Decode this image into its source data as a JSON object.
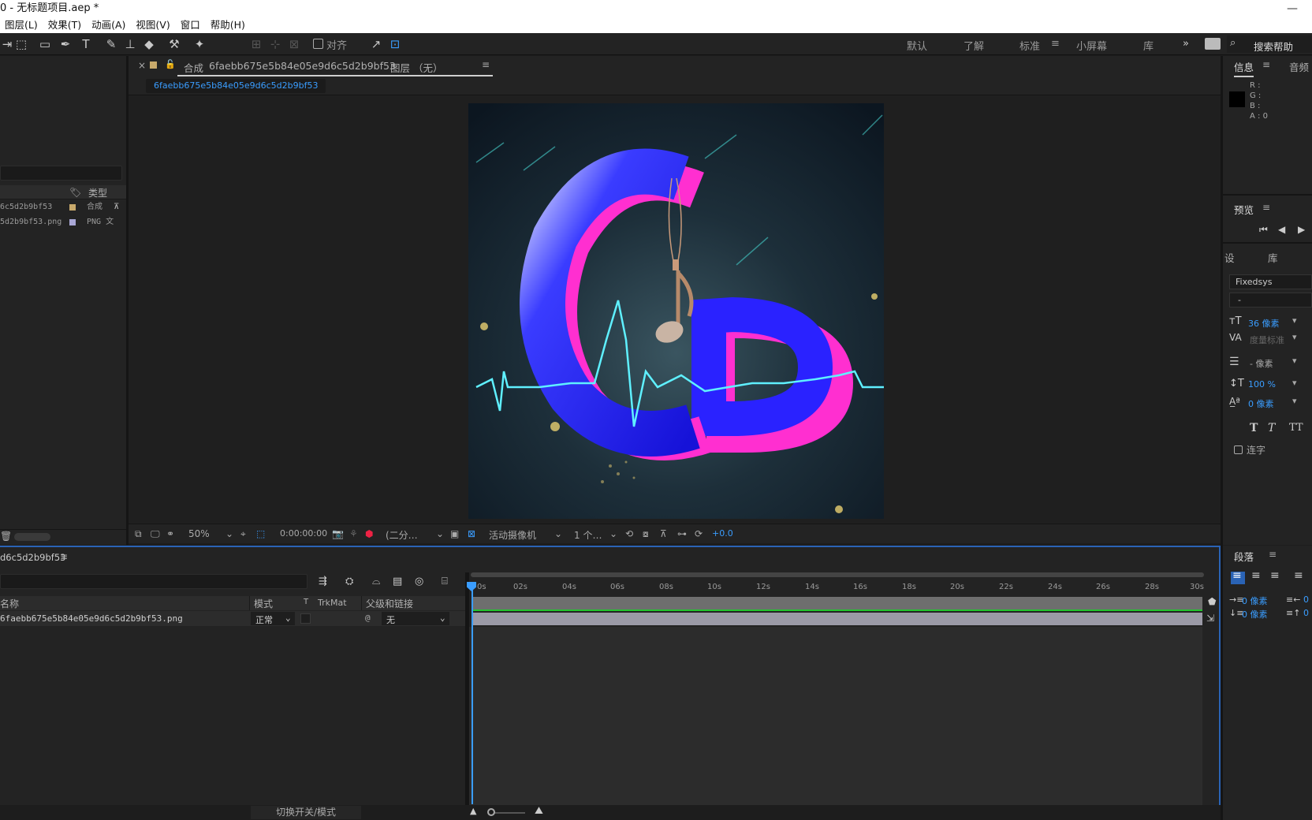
{
  "window": {
    "title": "0 - 无标题项目.aep *"
  },
  "menu": [
    "图层(L)",
    "效果(T)",
    "动画(A)",
    "视图(V)",
    "窗口",
    "帮助(H)"
  ],
  "toolbar": {
    "align_label": "对齐",
    "workspaces": [
      "默认",
      "了解",
      "标准",
      "小屏幕",
      "库"
    ],
    "active_workspace": "标准",
    "search_placeholder": "搜索帮助"
  },
  "project": {
    "type_header": "类型",
    "items": [
      {
        "name": "6c5d2b9bf53",
        "type": "合成",
        "color": "#c8a96b"
      },
      {
        "name": "5d2b9bf53.png",
        "type": "PNG 文",
        "color": "#a9a7d6"
      }
    ]
  },
  "composition": {
    "tab_prefix": "合成",
    "name": "6faebb675e5b84e05e9d6c5d2b9bf53",
    "layer_tab": "图层 （无）",
    "breadcrumb": "6faebb675e5b84e05e9d6c5d2b9bf53"
  },
  "viewer_controls": {
    "zoom": "50%",
    "timecode": "0:00:00:00",
    "resolution": "(二分…",
    "camera": "活动摄像机",
    "views": "1 个…",
    "exposure": "+0.0"
  },
  "info_panel": {
    "tab_info": "信息",
    "tab_audio": "音频",
    "r": "R :",
    "g": "G :",
    "b": "B :",
    "a": "A : 0"
  },
  "preview_panel": {
    "title": "预览"
  },
  "character_panel": {
    "tab_left": "设",
    "tab_lib": "库",
    "font": "Fixedsys",
    "font_style": "-",
    "size": "36 像素",
    "tracking": "度量标准",
    "leading": "- 像素",
    "vscale": "100 %",
    "baseline": "0 像素",
    "ligature_label": "连字"
  },
  "paragraph_panel": {
    "title": "段落",
    "indent_left": "0 像素",
    "indent_right": "0",
    "space_before": "0 像素",
    "space_after": "0"
  },
  "timeline": {
    "comp_tab": "d6c5d2b9bf53",
    "col_name": "名称",
    "col_mode": "模式",
    "col_t": "T",
    "col_trkmat": "TrkMat",
    "col_parent": "父级和链接",
    "layer": {
      "name": "6faebb675e5b84e05e9d6c5d2b9bf53.png",
      "mode": "正常",
      "parent": "无"
    },
    "ticks": [
      "0s",
      "02s",
      "04s",
      "06s",
      "08s",
      "10s",
      "12s",
      "14s",
      "16s",
      "18s",
      "20s",
      "22s",
      "24s",
      "26s",
      "28s",
      "30s"
    ],
    "toggle_label": "切换开关/模式"
  }
}
